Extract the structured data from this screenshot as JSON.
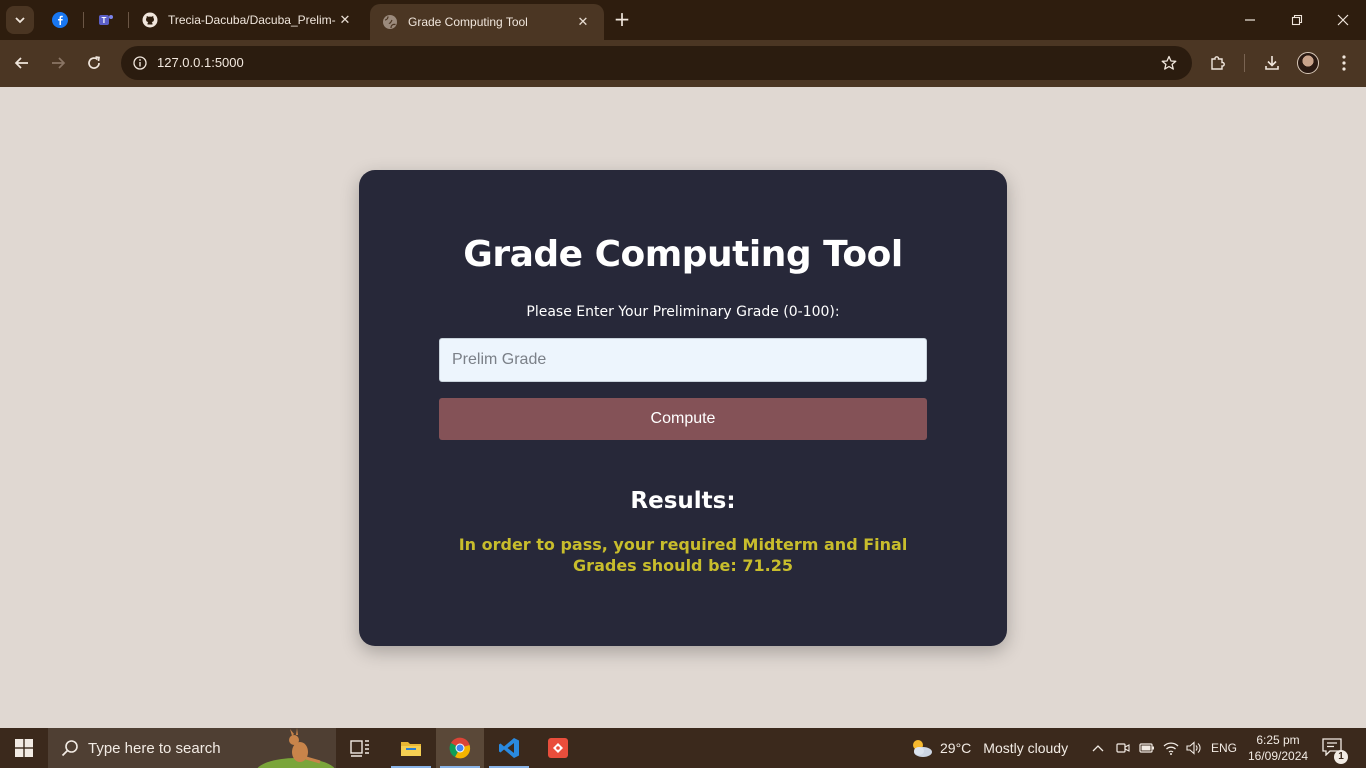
{
  "browser": {
    "tabs": [
      {
        "title": "Trecia-Dacuba/Dacuba_Prelim-L",
        "active": false
      },
      {
        "title": "Grade Computing Tool",
        "active": true
      }
    ],
    "pinned_tabs": [
      "facebook-icon",
      "teams-icon"
    ],
    "url": "127.0.0.1:5000"
  },
  "page": {
    "title": "Grade Computing Tool",
    "input_label": "Please Enter Your Preliminary Grade (0-100):",
    "input_placeholder": "Prelim Grade",
    "input_value": "",
    "compute_label": "Compute",
    "results_heading": "Results:",
    "result_message": "In order to pass, your required Midterm and Final Grades should be: 71.25",
    "colors": {
      "page_bg": "#e0d8d2",
      "card_bg": "#272839",
      "button_bg": "#845257",
      "result_text": "#c8bd2c"
    }
  },
  "taskbar": {
    "search_placeholder": "Type here to search",
    "apps": [
      "task-view-icon",
      "file-explorer-icon",
      "chrome-icon",
      "vscode-icon",
      "git-app-icon"
    ],
    "weather_temp": "29°C",
    "weather_desc": "Mostly cloudy",
    "language": "ENG",
    "time": "6:25 pm",
    "date": "16/09/2024",
    "notification_count": "1"
  }
}
